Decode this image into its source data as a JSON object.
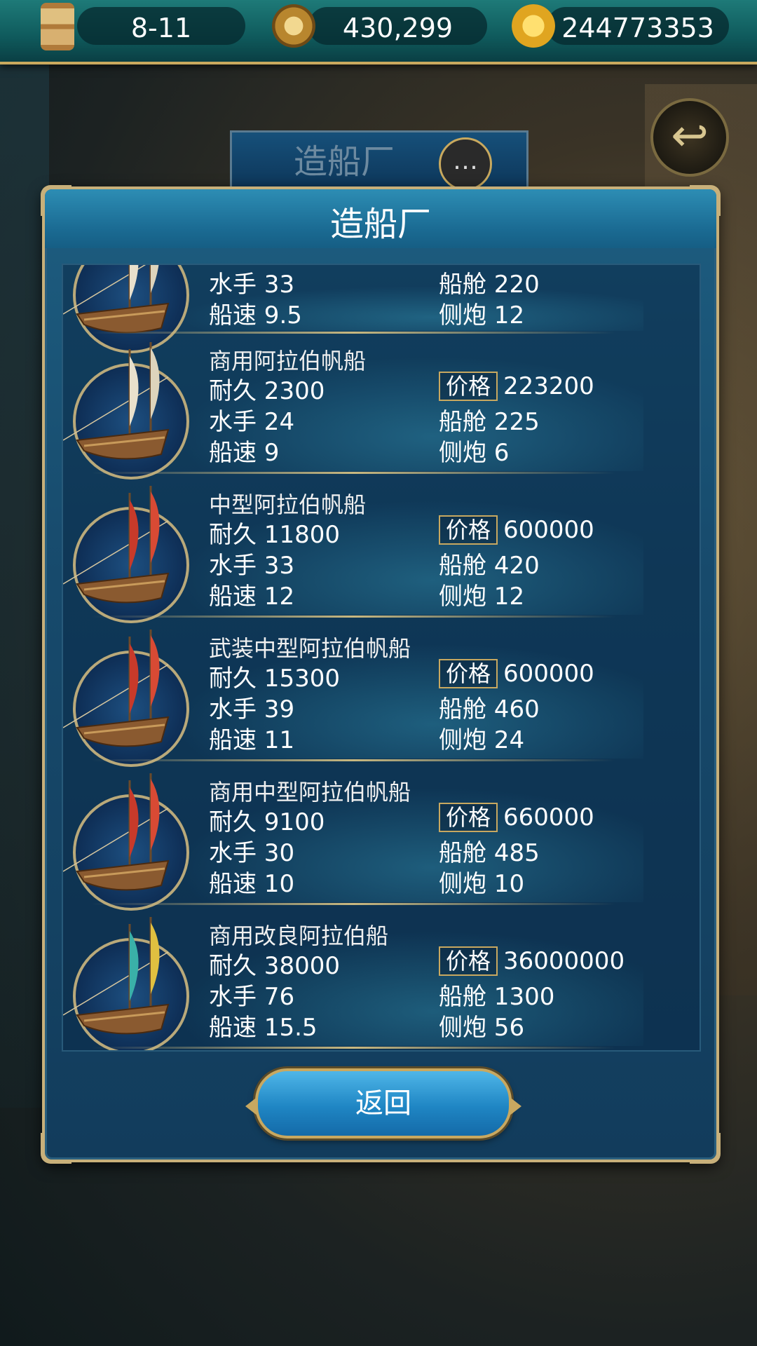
{
  "topbar": {
    "time": "8-11",
    "fame": "430,299",
    "gold": "244773353",
    "icons": [
      "hourglass-icon",
      "compass-icon",
      "gold-coin-icon"
    ]
  },
  "background": {
    "title": "造船厂",
    "chat_icon": "…",
    "back_icon": "↩"
  },
  "dialog": {
    "title": "造船厂",
    "return_label": "返回"
  },
  "labels": {
    "durability": "耐久",
    "crew": "水手",
    "speed": "船速",
    "price": "价格",
    "cabin": "船舱",
    "cannons": "侧炮"
  },
  "ships": [
    {
      "name": "",
      "durability": "",
      "crew": "33",
      "speed": "9.5",
      "price": "",
      "cabin": "220",
      "cannons": "12",
      "sail": "white"
    },
    {
      "name": "商用阿拉伯帆船",
      "durability": "2300",
      "crew": "24",
      "speed": "9",
      "price": "223200",
      "cabin": "225",
      "cannons": "6",
      "sail": "white"
    },
    {
      "name": "中型阿拉伯帆船",
      "durability": "11800",
      "crew": "33",
      "speed": "12",
      "price": "600000",
      "cabin": "420",
      "cannons": "12",
      "sail": "red-striped"
    },
    {
      "name": "武装中型阿拉伯帆船",
      "durability": "15300",
      "crew": "39",
      "speed": "11",
      "price": "600000",
      "cabin": "460",
      "cannons": "24",
      "sail": "red-striped"
    },
    {
      "name": "商用中型阿拉伯帆船",
      "durability": "9100",
      "crew": "30",
      "speed": "10",
      "price": "660000",
      "cabin": "485",
      "cannons": "10",
      "sail": "red-striped"
    },
    {
      "name": "商用改良阿拉伯船",
      "durability": "38000",
      "crew": "76",
      "speed": "15.5",
      "price": "36000000",
      "cabin": "1300",
      "cannons": "56",
      "sail": "teal-yellow"
    }
  ]
}
